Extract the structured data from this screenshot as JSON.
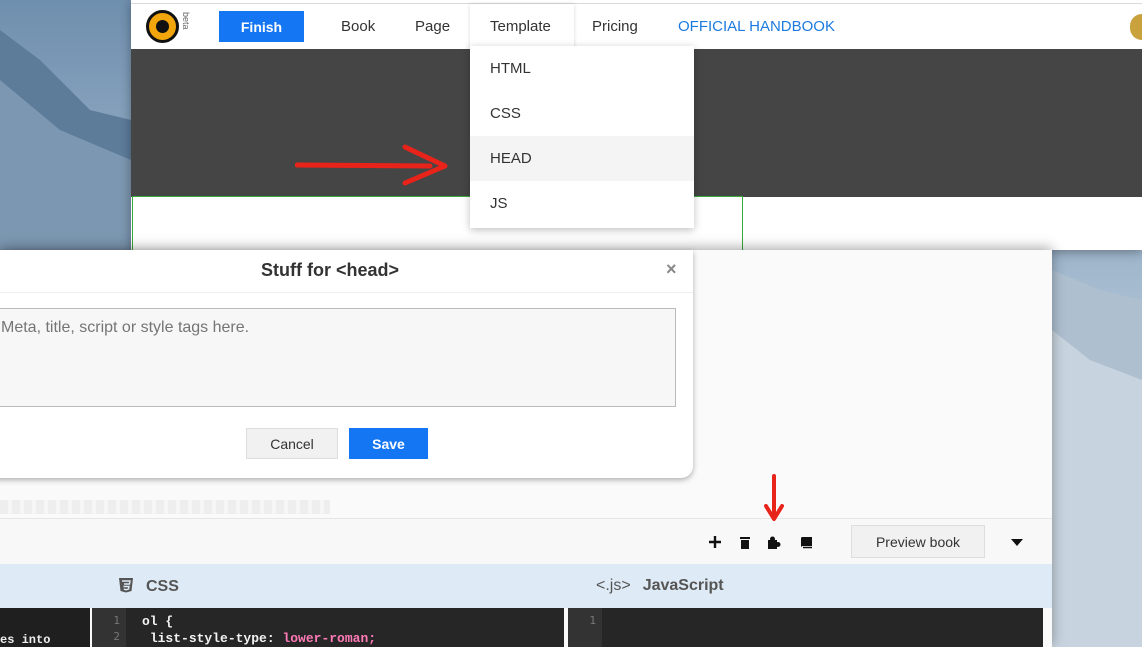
{
  "topbar": {
    "logo_badge": "beta",
    "finish_label": "Finish",
    "nav": [
      {
        "label": "Book"
      },
      {
        "label": "Page"
      },
      {
        "label": "Template"
      },
      {
        "label": "Pricing"
      },
      {
        "label": "OFFICIAL HANDBOOK"
      }
    ]
  },
  "template_menu": {
    "items": [
      {
        "label": "HTML",
        "active": false
      },
      {
        "label": "CSS",
        "active": false
      },
      {
        "label": "HEAD",
        "active": true
      },
      {
        "label": "JS",
        "active": false
      }
    ]
  },
  "modal": {
    "title": "Stuff for <head>",
    "close": "×",
    "textarea_placeholder": "Meta, title, script or style tags here.",
    "cancel_label": "Cancel",
    "save_label": "Save"
  },
  "toolbar": {
    "icons": [
      "plus-icon",
      "trash-icon",
      "puzzle-icon",
      "book-icon"
    ],
    "preview_label": "Preview book"
  },
  "editor": {
    "css_icon": "css3-icon",
    "css_label": "CSS",
    "js_prefix": "<.js>",
    "js_label": "JavaScript",
    "left_snippet": "es into",
    "css_gutter": [
      "1",
      "2"
    ],
    "css_code": [
      "ol {",
      "list-style-type:",
      "lower-roman;"
    ],
    "js_gutter": [
      "1"
    ]
  },
  "colors": {
    "accent": "#1476f2",
    "annotation": "#e8231a",
    "code_bg": "#262626",
    "editor_header": "#deeaf5"
  }
}
